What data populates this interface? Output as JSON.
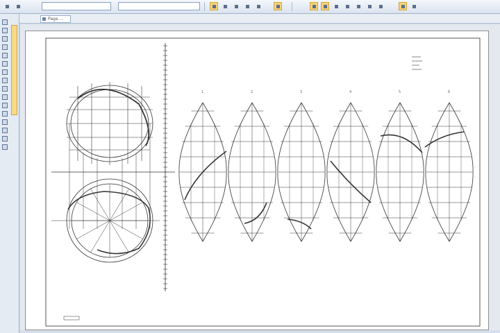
{
  "window": {
    "title": "",
    "active_tab": "Page ..."
  },
  "toolbar": {
    "layer_value": "",
    "style_value": "",
    "buttons": [
      {
        "name": "prop-button-1",
        "highlight": true
      },
      {
        "name": "prop-button-2",
        "highlight": false
      },
      {
        "name": "prop-button-3",
        "highlight": false
      },
      {
        "name": "prop-button-4",
        "highlight": false
      },
      {
        "name": "prop-button-5",
        "highlight": true
      },
      {
        "name": "snap-button-1",
        "highlight": true
      },
      {
        "name": "snap-button-2",
        "highlight": true
      },
      {
        "name": "snap-button-3",
        "highlight": false
      },
      {
        "name": "snap-button-4",
        "highlight": false
      },
      {
        "name": "snap-button-5",
        "highlight": false
      },
      {
        "name": "snap-button-6",
        "highlight": true
      }
    ]
  },
  "drawing": {
    "gore_numbers": [
      "1",
      "2",
      "3",
      "4",
      "5",
      "6"
    ],
    "title_block": ""
  },
  "colors": {
    "highlight": "#f6d27a",
    "chrome": "#dbe4f0",
    "sheet": "#ffffff",
    "line": "#333333"
  }
}
